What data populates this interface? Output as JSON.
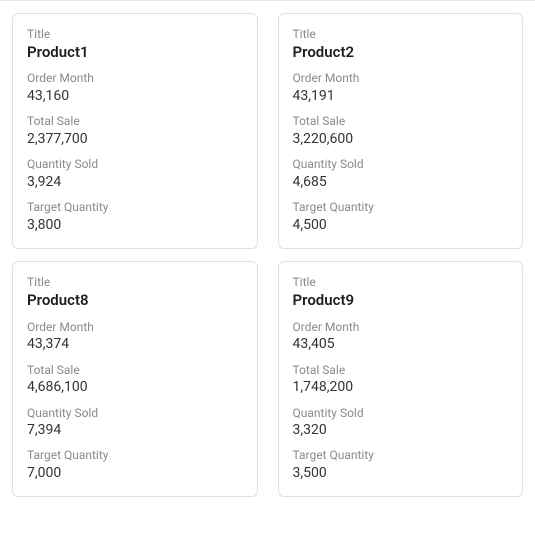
{
  "labels": {
    "title": "Title",
    "order_month": "Order Month",
    "total_sale": "Total Sale",
    "quantity_sold": "Quantity Sold",
    "target_quantity": "Target Quantity"
  },
  "cards": [
    {
      "title": "Product1",
      "order_month": "43,160",
      "total_sale": "2,377,700",
      "quantity_sold": "3,924",
      "target_quantity": "3,800"
    },
    {
      "title": "Product2",
      "order_month": "43,191",
      "total_sale": "3,220,600",
      "quantity_sold": "4,685",
      "target_quantity": "4,500"
    },
    {
      "title": "Product8",
      "order_month": "43,374",
      "total_sale": "4,686,100",
      "quantity_sold": "7,394",
      "target_quantity": "7,000"
    },
    {
      "title": "Product9",
      "order_month": "43,405",
      "total_sale": "1,748,200",
      "quantity_sold": "3,320",
      "target_quantity": "3,500"
    }
  ]
}
